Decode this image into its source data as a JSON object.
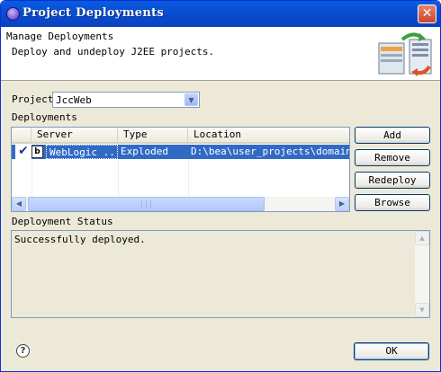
{
  "window": {
    "title": "Project Deployments",
    "close_glyph": "✕",
    "icon": "eclipse-app-icon"
  },
  "banner": {
    "title": "Manage Deployments",
    "description": "Deploy and undeploy J2EE projects.",
    "icon": "deploy-server-icon"
  },
  "project": {
    "label": "Project",
    "value": "JccWeb",
    "dropdown_glyph": "▼"
  },
  "deployments": {
    "label": "Deployments",
    "columns": [
      "Server",
      "Type",
      "Location"
    ],
    "rows": [
      {
        "checked": true,
        "check_glyph": "✔",
        "server_icon_text": "b",
        "server": "WebLogic ...",
        "type": "Exploded",
        "location": "D:\\bea\\user_projects\\domains\\my"
      }
    ],
    "scroll_left": "◀",
    "scroll_right": "▶",
    "thumb_grip": "|||"
  },
  "buttons": {
    "add": "Add",
    "remove": "Remove",
    "redeploy": "Redeploy",
    "browse": "Browse"
  },
  "status": {
    "label": "Deployment Status",
    "text": "Successfully deployed.",
    "scroll_up": "▲",
    "scroll_down": "▼"
  },
  "footer": {
    "help_glyph": "?",
    "ok": "OK"
  },
  "colors": {
    "titlebar": "#0a4fd0",
    "selection": "#316ac5",
    "close": "#c9452c"
  }
}
